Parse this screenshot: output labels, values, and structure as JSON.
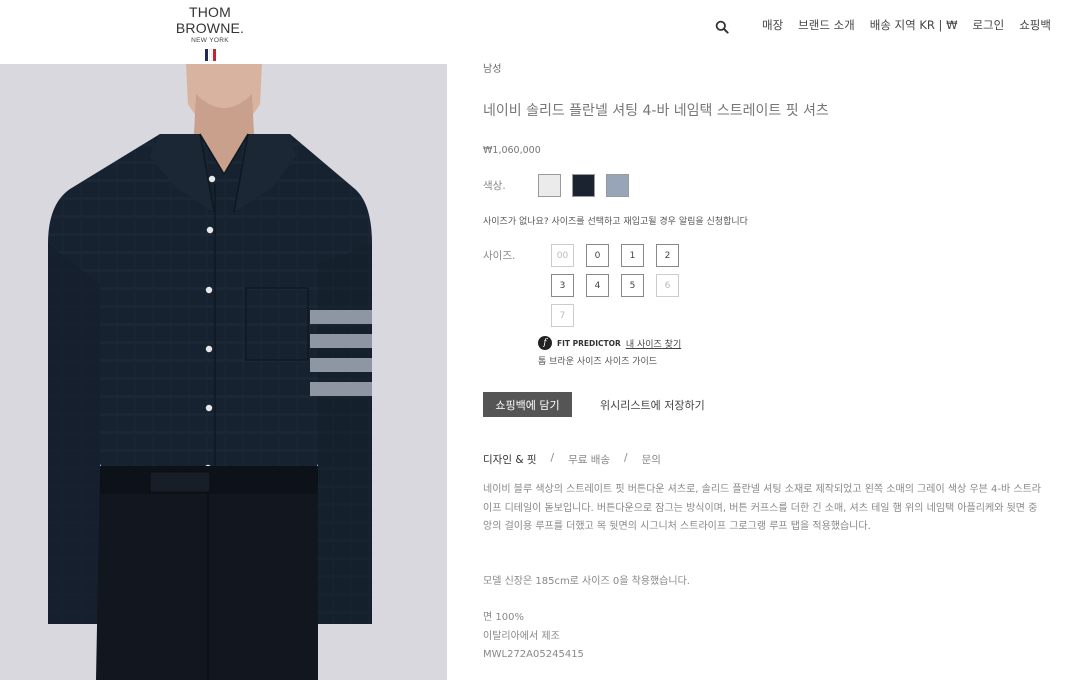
{
  "brand": {
    "name": "THOM BROWNE.",
    "city": "NEW YORK",
    "stripe_colors": [
      "#1e2a5a",
      "#ffffff",
      "#c4262e"
    ]
  },
  "header": {
    "search_icon": "search-icon",
    "nav": [
      "매장",
      "브랜드 소개",
      "배송 지역 KR | ₩",
      "로그인",
      "쇼핑백"
    ]
  },
  "product": {
    "category": "남성",
    "title": "네이비 솔리드 플란넬 셔팅 4-바 네임택 스트레이트 핏 셔츠",
    "price": "₩1,060,000",
    "color_label": "색상.",
    "swatches": [
      "#ebebeb",
      "#1b2230",
      "#98a4b8"
    ],
    "size_notice": "사이즈가 없나요? 사이즈를 선택하고 재입고될 경우 알림을 신청합니다",
    "size_label": "사이즈.",
    "sizes": [
      {
        "label": "00",
        "available": false
      },
      {
        "label": "0",
        "available": true
      },
      {
        "label": "1",
        "available": true
      },
      {
        "label": "2",
        "available": true
      },
      {
        "label": "3",
        "available": true
      },
      {
        "label": "4",
        "available": true
      },
      {
        "label": "5",
        "available": true
      },
      {
        "label": "6",
        "available": false
      },
      {
        "label": "7",
        "available": false
      }
    ],
    "fit_predictor_brand": "FIT PREDICTOR",
    "fit_predictor_link": "내 사이즈 찾기",
    "size_guide": "톰 브라운 사이즈 사이즈 가이드",
    "add_to_cart": "쇼핑백에 담기",
    "wishlist": "위시리스트에 저장하기",
    "tabs": [
      "디자인 & 핏",
      "무료 배송",
      "문의"
    ],
    "tab_separator": "/",
    "description": "네이비 블루 색상의 스트레이트 핏 버튼다운 셔츠로, 솔리드 플란넬 셔팅 소재로 제작되었고 왼쪽 소매의 그레이 색상 우븐 4-바 스트라이프 디테일이 돋보입니다. 버튼다운으로 잠그는 방식이며, 버튼 커프스를 더한 긴 소매, 셔츠 테일 햄 위의 네임택 아플리케와 뒷면 중앙의 걸이용 루프를 더했고 목 뒷면의 시그니처 스트라이프 그로그랭 루프 탭을 적용했습니다.",
    "model_info": "모델 신장은 185cm로 사이즈 0을 착용했습니다.",
    "composition": "면 100%",
    "origin": "이탈리아에서 제조",
    "sku": "MWL272A05245415"
  }
}
